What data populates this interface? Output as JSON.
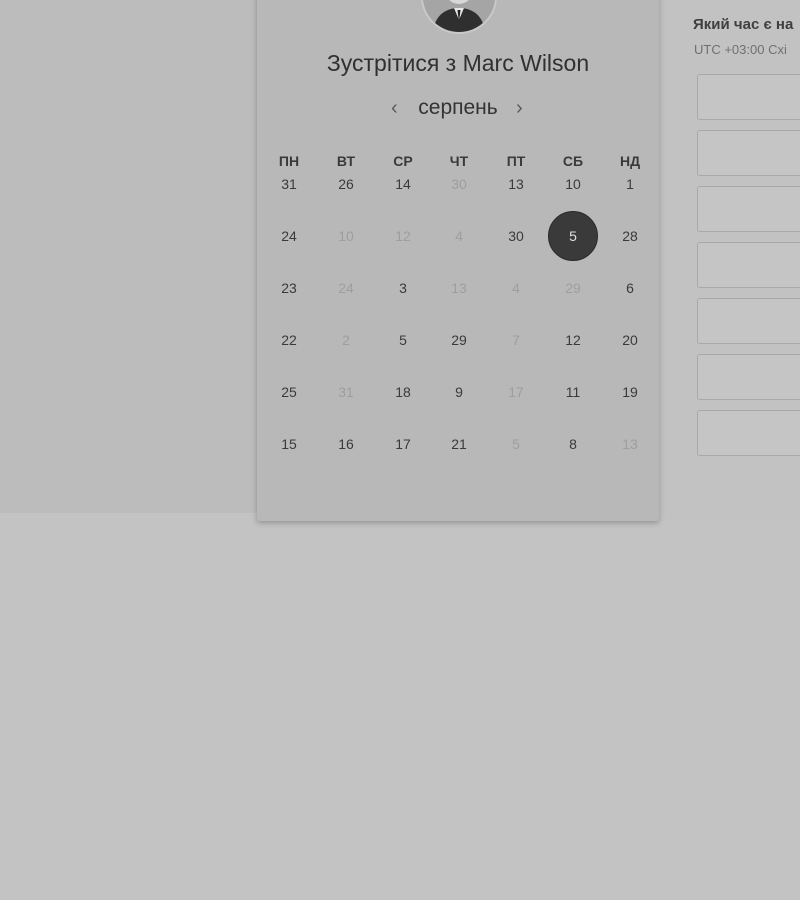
{
  "host": {
    "title": "Зустрітися з Marc Wilson",
    "avatar_icon": "person-photo-icon"
  },
  "calendar": {
    "month": "серпень",
    "prev_icon": "chevron-left-icon",
    "next_icon": "chevron-right-icon",
    "prev_glyph": "‹",
    "next_glyph": "›",
    "weekdays": [
      "ПН",
      "ВТ",
      "СР",
      "ЧТ",
      "ПТ",
      "СБ",
      "НД"
    ],
    "weeks": [
      [
        {
          "label": "31",
          "available": true
        },
        {
          "label": "26",
          "available": true
        },
        {
          "label": "14",
          "available": true
        },
        {
          "label": "30",
          "available": false
        },
        {
          "label": "13",
          "available": true
        },
        {
          "label": "10",
          "available": true
        },
        {
          "label": "1",
          "available": true
        }
      ],
      [
        {
          "label": "24",
          "available": true
        },
        {
          "label": "10",
          "available": false
        },
        {
          "label": "12",
          "available": false
        },
        {
          "label": "4",
          "available": false
        },
        {
          "label": "30",
          "available": true
        },
        {
          "label": "5",
          "available": true,
          "selected": true
        },
        {
          "label": "28",
          "available": true
        }
      ],
      [
        {
          "label": "23",
          "available": true
        },
        {
          "label": "24",
          "available": false
        },
        {
          "label": "3",
          "available": true
        },
        {
          "label": "13",
          "available": false
        },
        {
          "label": "4",
          "available": false
        },
        {
          "label": "29",
          "available": false
        },
        {
          "label": "6",
          "available": true
        }
      ],
      [
        {
          "label": "22",
          "available": true
        },
        {
          "label": "2",
          "available": false
        },
        {
          "label": "5",
          "available": true
        },
        {
          "label": "29",
          "available": true
        },
        {
          "label": "7",
          "available": false
        },
        {
          "label": "12",
          "available": true
        },
        {
          "label": "20",
          "available": true
        }
      ],
      [
        {
          "label": "25",
          "available": true
        },
        {
          "label": "31",
          "available": false
        },
        {
          "label": "18",
          "available": true
        },
        {
          "label": "9",
          "available": true
        },
        {
          "label": "17",
          "available": false
        },
        {
          "label": "11",
          "available": true
        },
        {
          "label": "19",
          "available": true
        }
      ],
      [
        {
          "label": "15",
          "available": true
        },
        {
          "label": "16",
          "available": true
        },
        {
          "label": "17",
          "available": true
        },
        {
          "label": "21",
          "available": true
        },
        {
          "label": "5",
          "available": false
        },
        {
          "label": "8",
          "available": true
        },
        {
          "label": "13",
          "available": false
        }
      ]
    ]
  },
  "timezone": {
    "question": "Який час є на",
    "value": "UTC +03:00 Схі"
  },
  "time_slots": [
    "",
    "",
    "",
    "",
    "",
    "",
    ""
  ],
  "colors": {
    "selected_day": "#3a3a3a",
    "muted_day": "#9e9e9e",
    "background": "#c3c3c3"
  }
}
